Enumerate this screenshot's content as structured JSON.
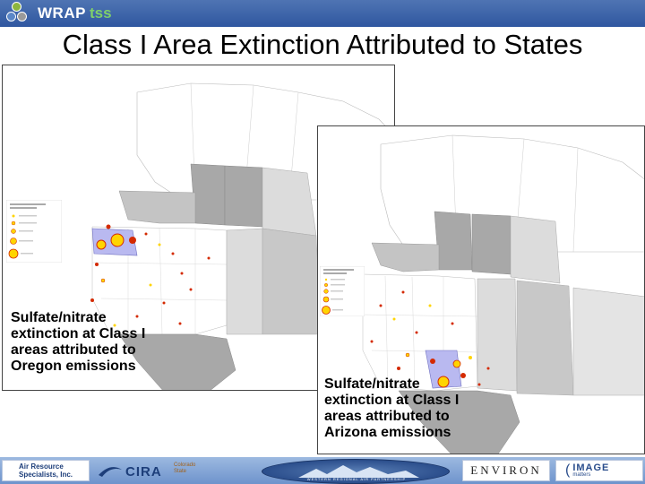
{
  "header": {
    "logo_word": "WRAP",
    "logo_suffix": "tss",
    "circle_colors": [
      "#8db63f",
      "#5b87c7",
      "#9a9a9a"
    ]
  },
  "title": "Class I Area Extinction Attributed to States",
  "panels": [
    {
      "id": "oregon",
      "caption_lines": [
        "Sulfate/nitrate",
        "extinction at Class I",
        "areas attributed to",
        "Oregon emissions"
      ],
      "highlight_color": "#b9b9f0"
    },
    {
      "id": "arizona",
      "caption_lines": [
        "Sulfate/nitrate",
        "extinction at Class I",
        "areas attributed to",
        "Arizona emissions"
      ],
      "highlight_color": "#b9b9f0"
    }
  ],
  "colors": {
    "accent": "#2f57a0",
    "gray_dark": "#a8a8a8",
    "gray_mid": "#c4c4c4",
    "gray_light": "#dcdcdc",
    "dot_yellow": "#ffd400",
    "dot_red": "#d42a00"
  },
  "footer": {
    "ars_lines": [
      "Air Resource",
      "Specialists, Inc."
    ],
    "cira_label": "CIRA",
    "cira_sub_lines": [
      "Colorado",
      "State"
    ],
    "wrap_banner": "WESTERN REGIONAL AIR PARTNERSHIP",
    "environ_label": "ENVIRON",
    "image_label": "IMAGE",
    "image_sub": "matters"
  }
}
